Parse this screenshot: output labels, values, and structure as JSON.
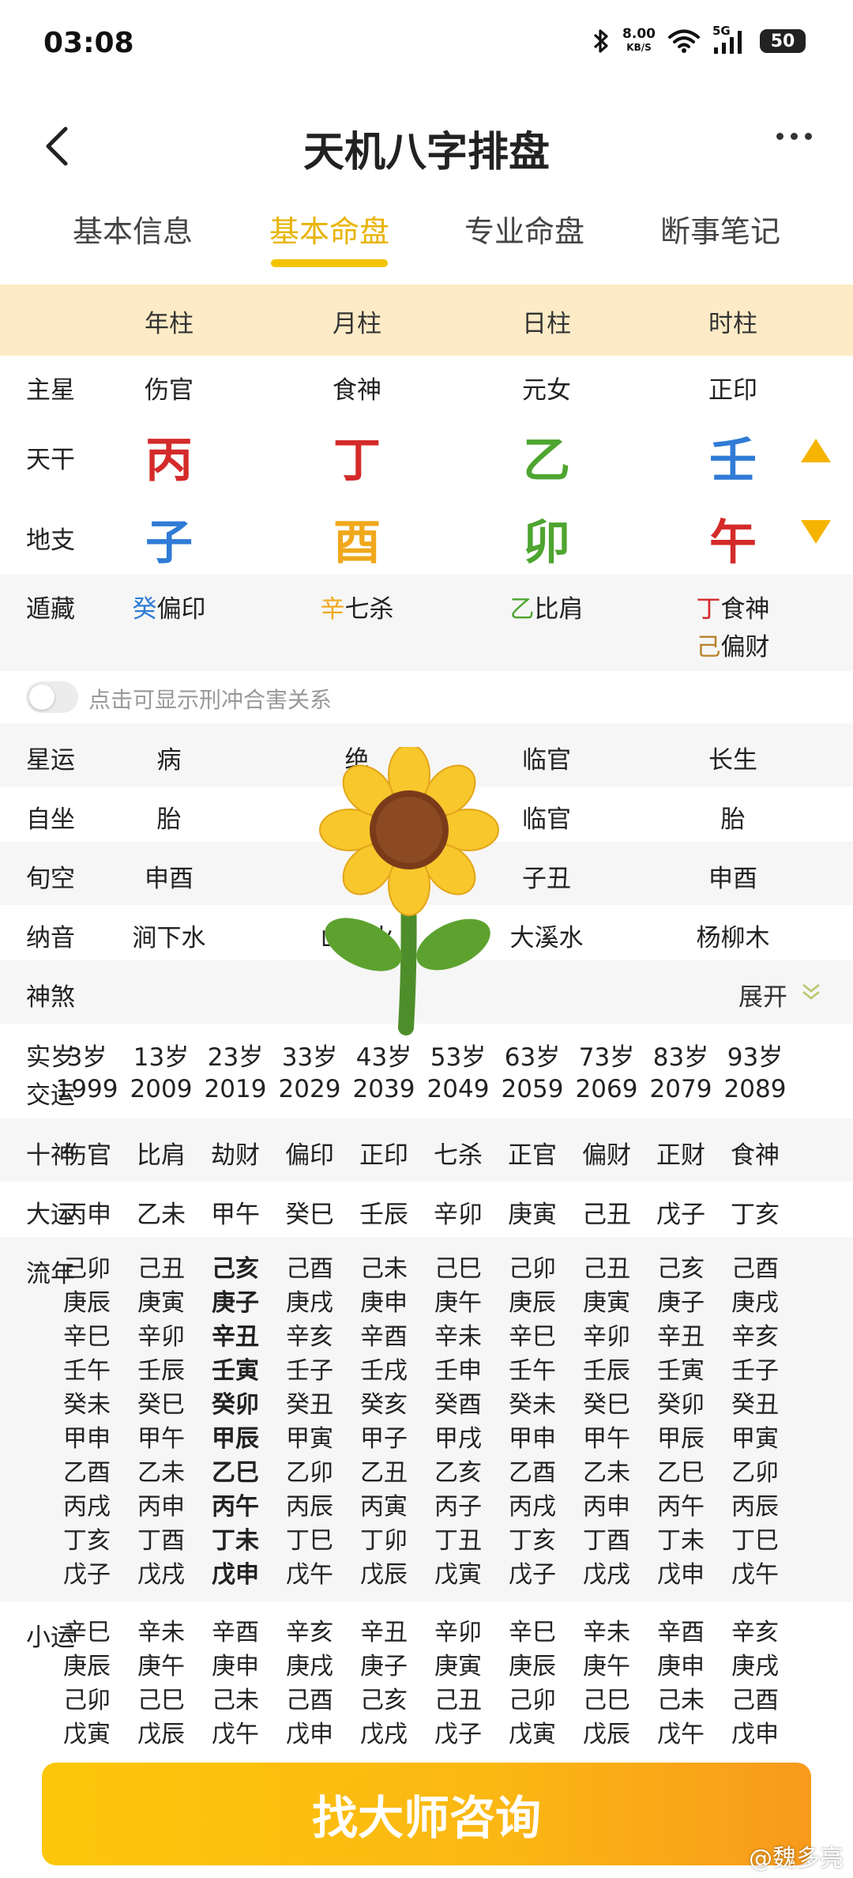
{
  "status_bar": {
    "time": "03:08",
    "net_speed_value": "8.00",
    "net_speed_unit": "KB/S",
    "signal_label": "5G",
    "battery": "50"
  },
  "header": {
    "title": "天机八字排盘"
  },
  "tabs": [
    {
      "label": "基本信息"
    },
    {
      "label": "基本命盘"
    },
    {
      "label": "专业命盘"
    },
    {
      "label": "断事笔记"
    }
  ],
  "pillars": {
    "labels": [
      "年柱",
      "月柱",
      "日柱",
      "时柱"
    ],
    "zhuxing": {
      "label": "主星",
      "values": [
        "伤官",
        "食神",
        "元女",
        "正印"
      ]
    },
    "tiangan": {
      "label": "天干",
      "values": [
        "丙",
        "丁",
        "乙",
        "壬"
      ],
      "colors": [
        "#D42A2A",
        "#D42A2A",
        "#4EA530",
        "#2F7BD6"
      ]
    },
    "dizhi": {
      "label": "地支",
      "values": [
        "子",
        "酉",
        "卯",
        "午"
      ],
      "colors": [
        "#2F7BD6",
        "#F0A81C",
        "#4EA530",
        "#D42A2A"
      ]
    },
    "canggan": {
      "label": "遁藏",
      "items": [
        [
          {
            "stem": "癸",
            "stem_color": "#2F7BD6",
            "god": "偏印"
          }
        ],
        [
          {
            "stem": "辛",
            "stem_color": "#F0A81C",
            "god": "七杀"
          }
        ],
        [
          {
            "stem": "乙",
            "stem_color": "#4EA530",
            "god": "比肩"
          }
        ],
        [
          {
            "stem": "丁",
            "stem_color": "#D42A2A",
            "god": "食神"
          },
          {
            "stem": "己",
            "stem_color": "#B8812A",
            "god": "偏财"
          }
        ]
      ]
    },
    "toggle_label": "点击可显示刑冲合害关系",
    "xingyun": {
      "label": "星运",
      "values": [
        "病",
        "绝",
        "临官",
        "长生"
      ]
    },
    "zizuo": {
      "label": "自坐",
      "values": [
        "胎",
        "",
        "临官",
        "胎"
      ]
    },
    "xunkong": {
      "label": "旬空",
      "values": [
        "申酉",
        "",
        "子丑",
        "申酉"
      ]
    },
    "nayin": {
      "label": "纳音",
      "values": [
        "涧下水",
        "山下火",
        "大溪水",
        "杨柳木"
      ]
    },
    "shensha": {
      "label": "神煞",
      "expand": "展开"
    }
  },
  "dayun": {
    "shisui_label": "实岁",
    "jiaoyun_label": "交运",
    "ages": [
      "3岁",
      "13岁",
      "23岁",
      "33岁",
      "43岁",
      "53岁",
      "63岁",
      "73岁",
      "83岁",
      "93岁"
    ],
    "years": [
      "1999",
      "2009",
      "2019",
      "2029",
      "2039",
      "2049",
      "2059",
      "2069",
      "2079",
      "2089"
    ],
    "shishen_label": "十神",
    "shishen": [
      "伤官",
      "比肩",
      "劫财",
      "偏印",
      "正印",
      "七杀",
      "正官",
      "偏财",
      "正财",
      "食神"
    ],
    "dayun_label": "大运",
    "ganzhi": [
      "丙申",
      "乙未",
      "甲午",
      "癸巳",
      "壬辰",
      "辛卯",
      "庚寅",
      "己丑",
      "戊子",
      "丁亥"
    ]
  },
  "liunian": {
    "label": "流年",
    "columns": [
      [
        "己卯",
        "庚辰",
        "辛巳",
        "壬午",
        "癸未",
        "甲申",
        "乙酉",
        "丙戌",
        "丁亥",
        "戊子"
      ],
      [
        "己丑",
        "庚寅",
        "辛卯",
        "壬辰",
        "癸巳",
        "甲午",
        "乙未",
        "丙申",
        "丁酉",
        "戊戌"
      ],
      [
        "己亥",
        "庚子",
        "辛丑",
        "壬寅",
        "癸卯",
        "甲辰",
        "乙巳",
        "丙午",
        "丁未",
        "戊申"
      ],
      [
        "己酉",
        "庚戌",
        "辛亥",
        "壬子",
        "癸丑",
        "甲寅",
        "乙卯",
        "丙辰",
        "丁巳",
        "戊午"
      ],
      [
        "己未",
        "庚申",
        "辛酉",
        "壬戌",
        "癸亥",
        "甲子",
        "乙丑",
        "丙寅",
        "丁卯",
        "戊辰"
      ],
      [
        "己巳",
        "庚午",
        "辛未",
        "壬申",
        "癸酉",
        "甲戌",
        "乙亥",
        "丙子",
        "丁丑",
        "戊寅"
      ],
      [
        "己卯",
        "庚辰",
        "辛巳",
        "壬午",
        "癸未",
        "甲申",
        "乙酉",
        "丙戌",
        "丁亥",
        "戊子"
      ],
      [
        "己丑",
        "庚寅",
        "辛卯",
        "壬辰",
        "癸巳",
        "甲午",
        "乙未",
        "丙申",
        "丁酉",
        "戊戌"
      ],
      [
        "己亥",
        "庚子",
        "辛丑",
        "壬寅",
        "癸卯",
        "甲辰",
        "乙巳",
        "丙午",
        "丁未",
        "戊申"
      ],
      [
        "己酉",
        "庚戌",
        "辛亥",
        "壬子",
        "癸丑",
        "甲寅",
        "乙卯",
        "丙辰",
        "丁巳",
        "戊午"
      ]
    ]
  },
  "xiaoyun": {
    "label": "小运",
    "columns": [
      [
        "辛巳",
        "庚辰",
        "己卯",
        "戊寅"
      ],
      [
        "辛未",
        "庚午",
        "己巳",
        "戊辰"
      ],
      [
        "辛酉",
        "庚申",
        "己未",
        "戊午"
      ],
      [
        "辛亥",
        "庚戌",
        "己酉",
        "戊申"
      ],
      [
        "辛丑",
        "庚子",
        "己亥",
        "戊戌"
      ],
      [
        "辛卯",
        "庚寅",
        "己丑",
        "戊子"
      ],
      [
        "辛巳",
        "庚辰",
        "己卯",
        "戊寅"
      ],
      [
        "辛未",
        "庚午",
        "己巳",
        "戊辰"
      ],
      [
        "辛酉",
        "庚申",
        "己未",
        "戊午"
      ],
      [
        "辛亥",
        "庚戌",
        "己酉",
        "戊申"
      ]
    ]
  },
  "cta": {
    "label": "找大师咨询"
  },
  "watermark": "@魏多亮",
  "overlay": {
    "icon": "sunflower-sticker"
  }
}
